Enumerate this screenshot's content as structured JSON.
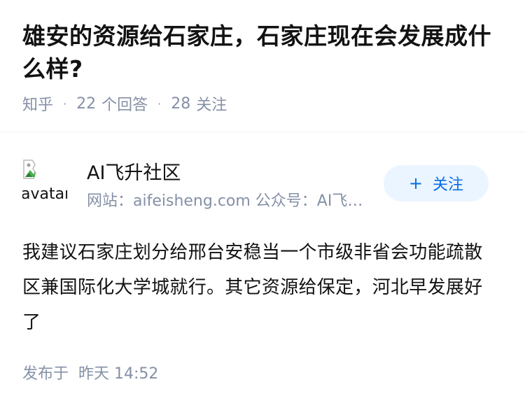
{
  "question": {
    "title": "雄安的资源给石家庄，石家庄现在会发展成什么样?",
    "source": "知乎",
    "answer_count": "22",
    "answer_label": "个回答",
    "follower_count": "28",
    "follower_label": "关注"
  },
  "author": {
    "avatar_alt": "avatar",
    "name": "AI飞升社区",
    "bio": "网站：aifeisheng.com 公众号：AI飞升社区",
    "follow_label": "关注",
    "follow_icon": "plus-icon"
  },
  "answer": {
    "content": "我建议石家庄划分给邢台安稳当一个市级非省会功能疏散区兼国际化大学城就行。其它资源给保定，河北早发展好了",
    "published_label": "发布于",
    "published_time": "昨天 14:52"
  },
  "colors": {
    "text": "#121212",
    "muted": "#8590a6",
    "accent": "#056de8",
    "button_bg": "#ebf5ff"
  }
}
